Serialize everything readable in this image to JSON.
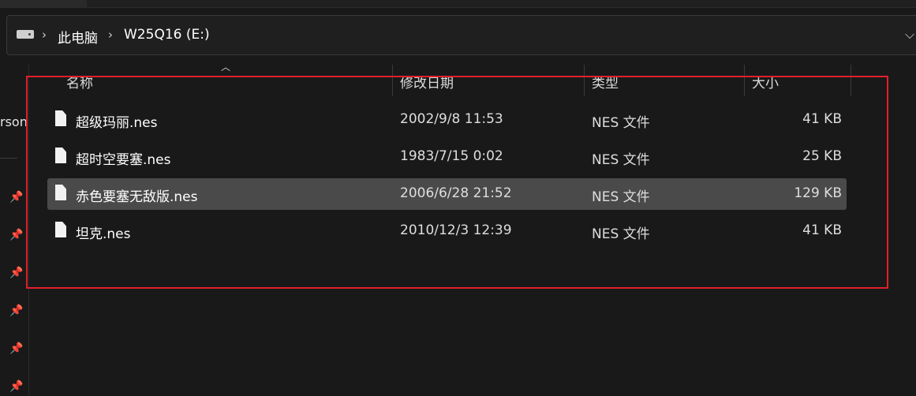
{
  "address": {
    "crumbs": [
      "此电脑",
      "W25Q16 (E:)"
    ],
    "chevron": "›",
    "dropdown": "⌵"
  },
  "sidebar": {
    "partial_label": "rson",
    "pin_icon": "pin-icon"
  },
  "columns": [
    {
      "label": "名称"
    },
    {
      "label": "修改日期"
    },
    {
      "label": "类型"
    },
    {
      "label": "大小"
    }
  ],
  "sort_indicator": "︿",
  "files": [
    {
      "name": "超级玛丽.nes",
      "modified": "2002/9/8 11:53",
      "type": "NES 文件",
      "size": "41 KB",
      "selected": false
    },
    {
      "name": "超时空要塞.nes",
      "modified": "1983/7/15 0:02",
      "type": "NES 文件",
      "size": "25 KB",
      "selected": false
    },
    {
      "name": "赤色要塞无敌版.nes",
      "modified": "2006/6/28 21:52",
      "type": "NES 文件",
      "size": "129 KB",
      "selected": true
    },
    {
      "name": "坦克.nes",
      "modified": "2010/12/3 12:39",
      "type": "NES 文件",
      "size": "41 KB",
      "selected": false
    }
  ],
  "colors": {
    "background": "#191919",
    "selected_row": "#4a4a4a",
    "highlight_box": "#e0202a"
  }
}
